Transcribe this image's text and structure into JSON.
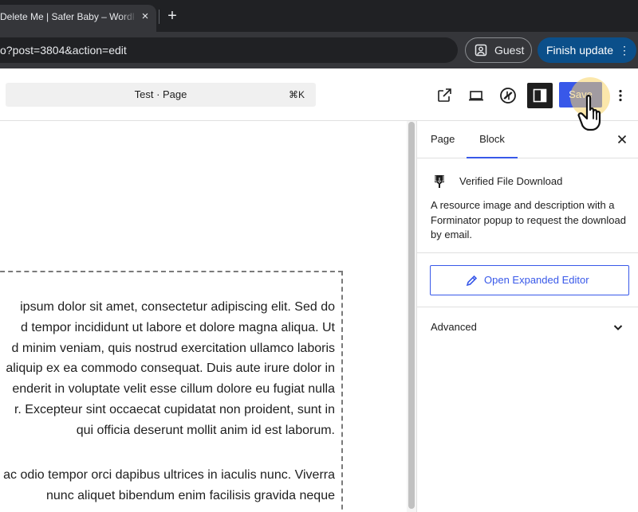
{
  "browser": {
    "tab_title": "Delete Me | Safer Baby – WordPress",
    "tab_close": "×",
    "new_tab": "+",
    "url": "o?post=3804&action=edit",
    "guest_label": "Guest",
    "finish_update_label": "Finish update",
    "finish_menu": "⋮"
  },
  "editor": {
    "command_title": "Test · Page",
    "command_shortcut": "⌘K",
    "save_label": "Save",
    "more_menu": "⋮"
  },
  "content": {
    "paragraph1": [
      "ipsum dolor sit amet, consectetur adipiscing elit. Sed do",
      "d tempor incididunt ut labore et dolore magna aliqua. Ut",
      "d minim veniam, quis nostrud exercitation ullamco laboris",
      "aliquip ex ea commodo consequat. Duis aute irure dolor in",
      "enderit in voluptate velit esse cillum dolore eu fugiat nulla",
      "r. Excepteur sint occaecat cupidatat non proident, sunt in",
      "qui officia deserunt mollit anim id est laborum."
    ],
    "paragraph2": [
      "ac odio tempor orci dapibus ultrices in iaculis nunc. Viverra",
      "nunc aliquet bibendum enim facilisis gravida neque"
    ]
  },
  "sidebar": {
    "tabs": [
      {
        "label": "Page",
        "active": false
      },
      {
        "label": "Block",
        "active": true
      }
    ],
    "block_title": "Verified File Download",
    "block_description": "A resource image and description with a Forminator popup to request the download by email.",
    "open_editor_label": "Open Expanded Editor",
    "advanced_label": "Advanced"
  },
  "colors": {
    "wp_accent": "#3858e9",
    "finish_update_bg": "#0b4f8a",
    "chrome_dark": "#202124"
  },
  "icons": {
    "guest": "guest-profile-icon",
    "view": "external-link-icon",
    "device": "laptop-preview-icon",
    "jetpack": "jetpack-icon",
    "settings": "sidebar-settings-icon",
    "block": "download-marker-icon",
    "edit": "pencil-icon",
    "advanced": "chevron-down-icon",
    "close": "close-icon",
    "pointer": "hand-cursor-icon"
  }
}
